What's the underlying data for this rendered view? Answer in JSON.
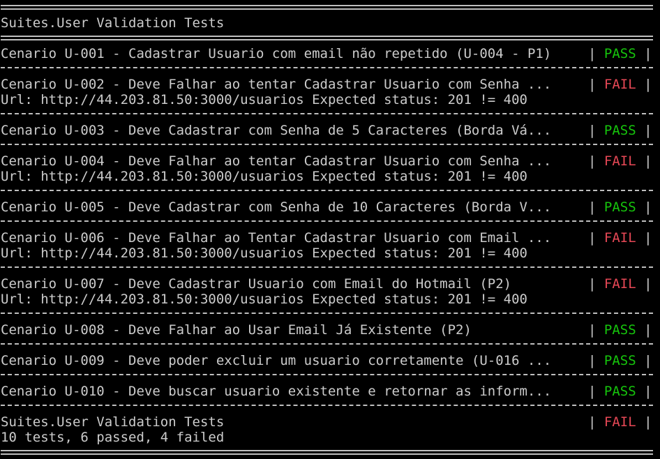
{
  "suite_title": "Suites.User Validation Tests",
  "colors": {
    "pass": "#16c60c",
    "fail": "#e74856",
    "text": "#cccccc",
    "background": "#000000"
  },
  "tests": [
    {
      "name": "Cenario U-001 - Cadastrar Usuario com email não repetido (U-004 - P1)",
      "status": "PASS",
      "detail": ""
    },
    {
      "name": "Cenario U-002 - Deve Falhar ao tentar Cadastrar Usuario com Senha ...",
      "status": "FAIL",
      "detail": "Url: http://44.203.81.50:3000/usuarios Expected status: 201 != 400"
    },
    {
      "name": "Cenario U-003 - Deve Cadastrar com Senha de 5 Caracteres (Borda Vá...",
      "status": "PASS",
      "detail": ""
    },
    {
      "name": "Cenario U-004 - Deve Falhar ao tentar Cadastrar Usuario com Senha ...",
      "status": "FAIL",
      "detail": "Url: http://44.203.81.50:3000/usuarios Expected status: 201 != 400"
    },
    {
      "name": "Cenario U-005 - Deve Cadastrar com Senha de 10 Caracteres (Borda V...",
      "status": "PASS",
      "detail": ""
    },
    {
      "name": "Cenario U-006 - Deve Falhar ao Tentar Cadastrar Usuario com Email ...",
      "status": "FAIL",
      "detail": "Url: http://44.203.81.50:3000/usuarios Expected status: 201 != 400"
    },
    {
      "name": "Cenario U-007 - Deve Cadastrar Usuario com Email do Hotmail (P2)",
      "status": "FAIL",
      "detail": "Url: http://44.203.81.50:3000/usuarios Expected status: 201 != 400"
    },
    {
      "name": "Cenario U-008 - Deve Falhar ao Usar Email Já Existente (P2)",
      "status": "PASS",
      "detail": ""
    },
    {
      "name": "Cenario U-009 - Deve poder excluir um usuario corretamente (U-016 ...",
      "status": "PASS",
      "detail": ""
    },
    {
      "name": "Cenario U-010 - Deve buscar usuario existente e retornar as inform...",
      "status": "PASS",
      "detail": ""
    }
  ],
  "summary": {
    "title": "Suites.User Validation Tests",
    "status": "FAIL",
    "stats": "10 tests, 6 passed, 4 failed"
  }
}
